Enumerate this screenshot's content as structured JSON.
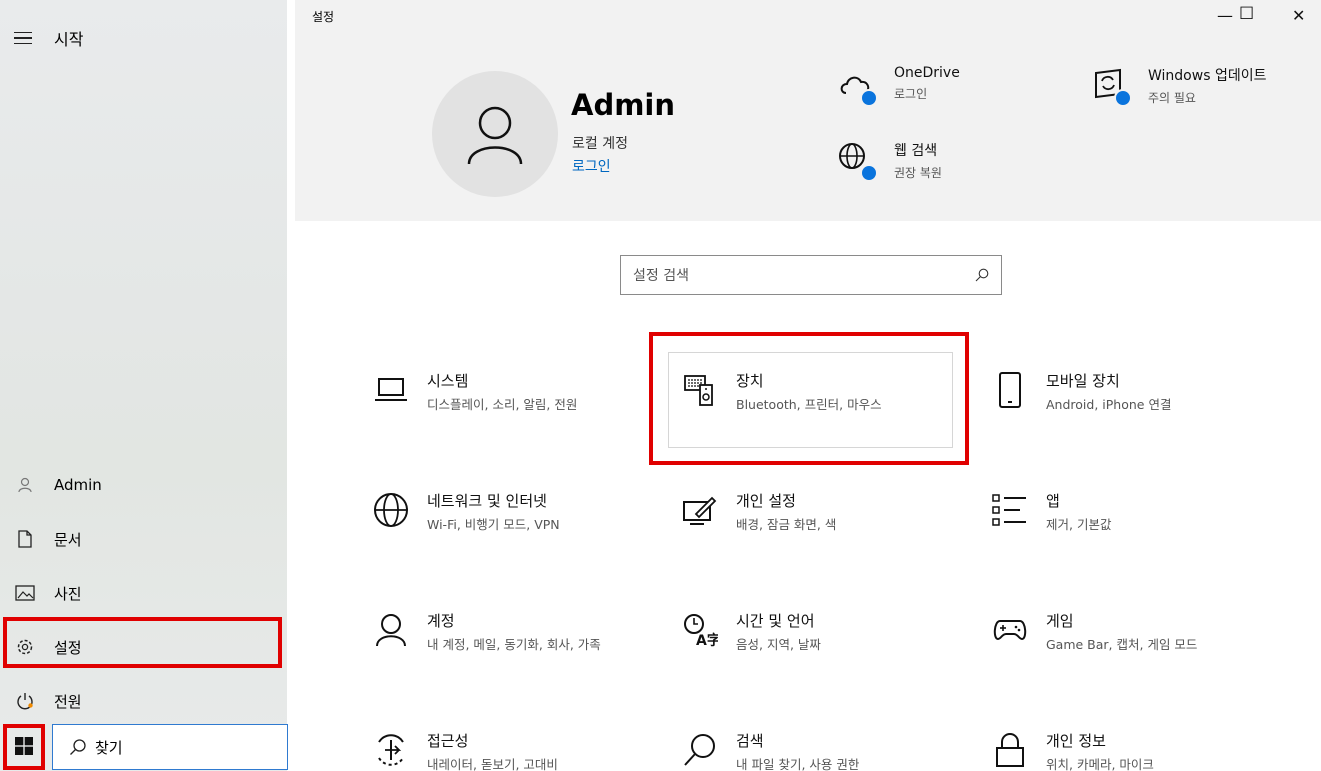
{
  "start_menu": {
    "title": "시작",
    "items": [
      {
        "label": "Admin",
        "icon": "user-icon"
      },
      {
        "label": "문서",
        "icon": "document-icon"
      },
      {
        "label": "사진",
        "icon": "picture-icon"
      },
      {
        "label": "설정",
        "icon": "gear-icon"
      },
      {
        "label": "전원",
        "icon": "power-icon"
      }
    ]
  },
  "taskbar": {
    "search_text": "찾기",
    "search_icon": "search-icon"
  },
  "settings_window": {
    "title": "설정",
    "controls": {
      "minimize": "—",
      "maximize": "☐",
      "close": "✕"
    },
    "account": {
      "name": "Admin",
      "type": "로컬 계정",
      "sign_in": "로그인"
    },
    "status": [
      {
        "title": "OneDrive",
        "subtitle": "로그인",
        "icon": "cloud-icon"
      },
      {
        "title": "웹 검색",
        "subtitle": "권장 복원",
        "icon": "globe-icon"
      },
      {
        "title": "Windows 업데이트",
        "subtitle": "주의 필요",
        "icon": "update-icon"
      }
    ],
    "search_placeholder": "설정 검색",
    "tiles": [
      {
        "title": "시스템",
        "subtitle": "디스플레이, 소리, 알림, 전원",
        "icon": "laptop-icon"
      },
      {
        "title": "장치",
        "subtitle": "Bluetooth, 프린터, 마우스",
        "icon": "devices-icon"
      },
      {
        "title": "모바일 장치",
        "subtitle": "Android, iPhone 연결",
        "icon": "phone-icon"
      },
      {
        "title": "네트워크 및 인터넷",
        "subtitle": "Wi-Fi, 비행기 모드, VPN",
        "icon": "globe-icon"
      },
      {
        "title": "개인 설정",
        "subtitle": "배경, 잠금 화면, 색",
        "icon": "paint-icon"
      },
      {
        "title": "앱",
        "subtitle": "제거, 기본값",
        "icon": "apps-list-icon"
      },
      {
        "title": "계정",
        "subtitle": "내 계정, 메일, 동기화, 회사, 가족",
        "icon": "account-icon"
      },
      {
        "title": "시간 및 언어",
        "subtitle": "음성, 지역, 날짜",
        "icon": "time-language-icon"
      },
      {
        "title": "게임",
        "subtitle": "Game Bar, 캡처, 게임 모드",
        "icon": "gamepad-icon"
      },
      {
        "title": "접근성",
        "subtitle": "내레이터, 돋보기, 고대비",
        "icon": "accessibility-icon"
      },
      {
        "title": "검색",
        "subtitle": "내 파일 찾기, 사용 권한",
        "icon": "search-icon"
      },
      {
        "title": "개인 정보",
        "subtitle": "위치, 카메라, 마이크",
        "icon": "lock-icon"
      }
    ]
  },
  "colors": {
    "highlight": "#e00000",
    "accent": "#0067c0",
    "badge": "#0a74dd"
  }
}
